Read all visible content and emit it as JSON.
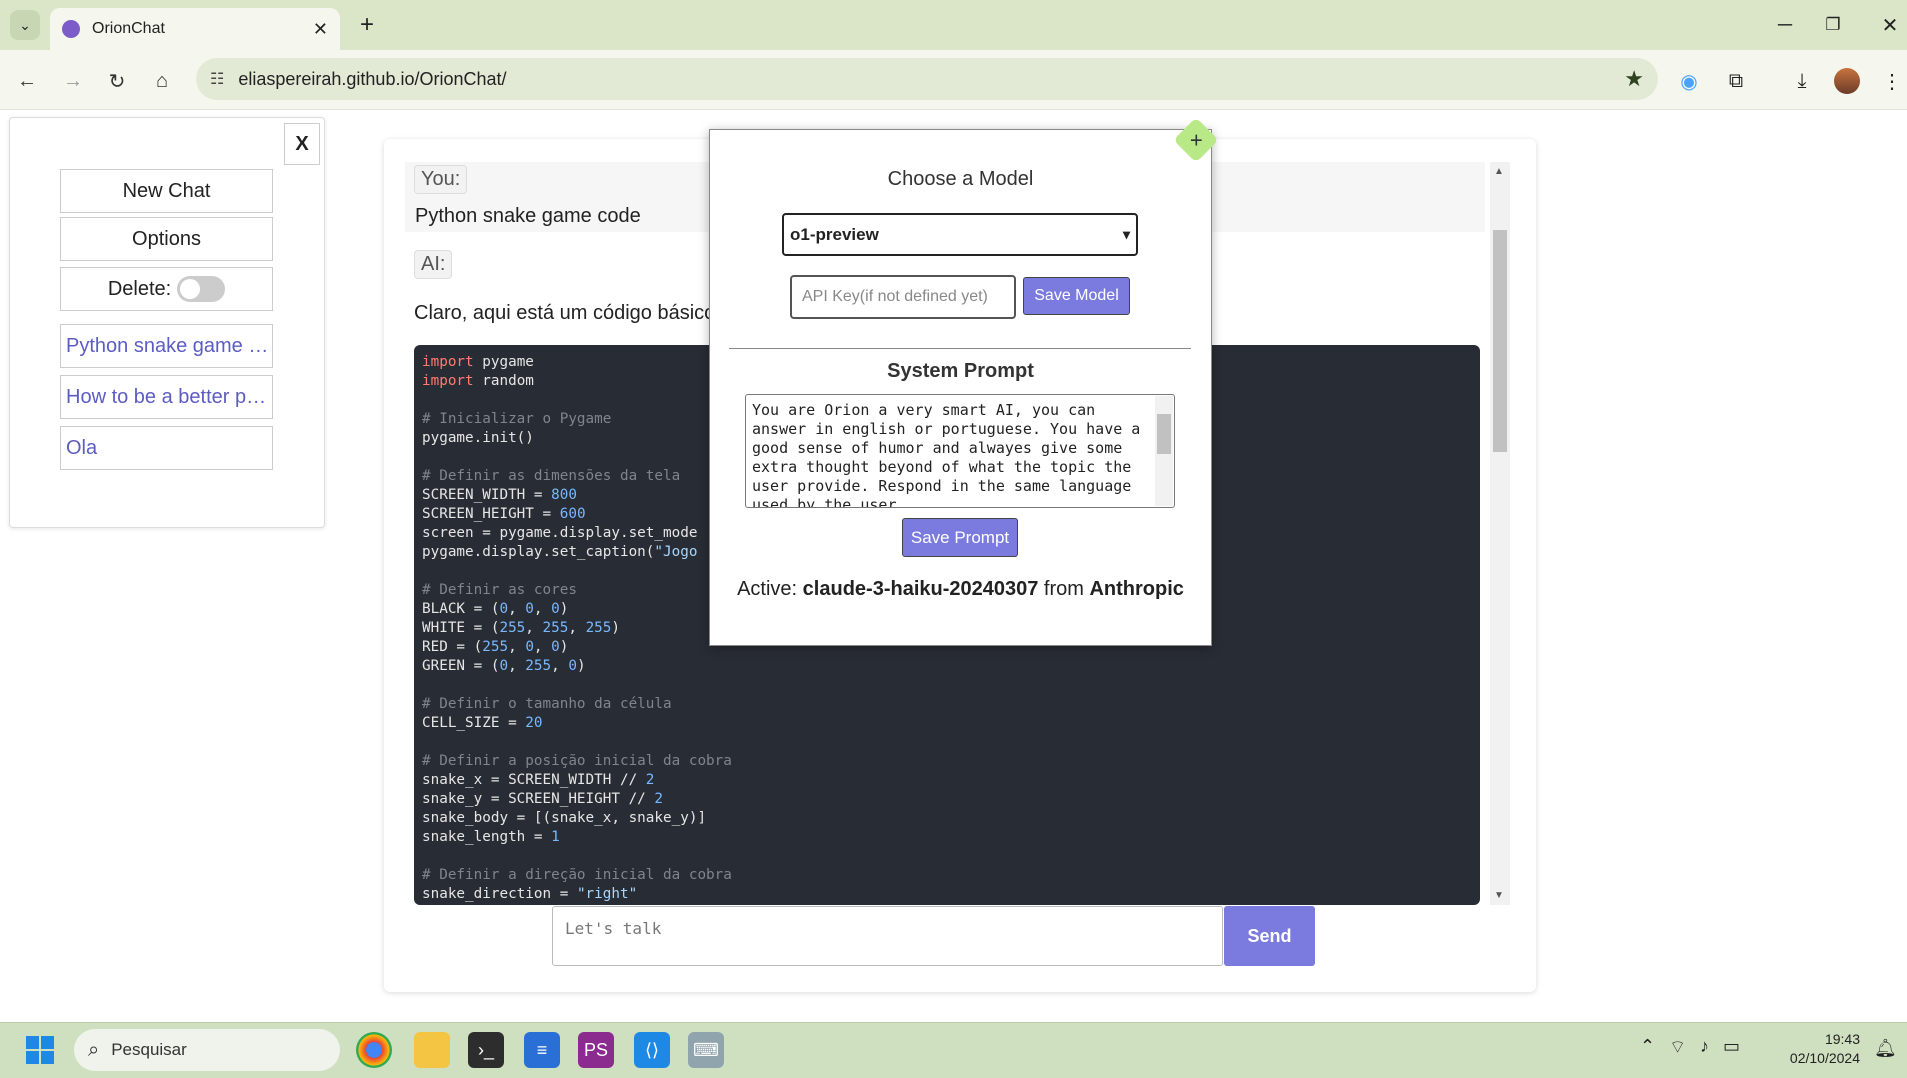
{
  "browser": {
    "tab_title": "OrionChat",
    "tab_close": "✕",
    "new_tab": "+",
    "url": "eliaspereirah.github.io/OrionChat/",
    "window_controls": [
      "─",
      "❐",
      "✕"
    ]
  },
  "sidebar": {
    "close_label": "X",
    "new_chat": "New Chat",
    "options": "Options",
    "delete_label": "Delete:",
    "history": [
      "Python snake game …",
      "How to be a better p…",
      "Ola"
    ]
  },
  "chat": {
    "you_tag": "You:",
    "user_message": "Python snake game code",
    "ai_tag": "AI:",
    "ai_intro": "Claro, aqui está um código básico",
    "input_placeholder": "Let's talk",
    "send_label": "Send",
    "code_lines": [
      [
        {
          "t": "import",
          "c": "kw"
        },
        {
          "t": " pygame",
          "c": ""
        }
      ],
      [
        {
          "t": "import",
          "c": "kw"
        },
        {
          "t": " random",
          "c": ""
        }
      ],
      [],
      [
        {
          "t": "# Inicializar o Pygame",
          "c": "cm"
        }
      ],
      [
        {
          "t": "pygame.init()",
          "c": ""
        }
      ],
      [],
      [
        {
          "t": "# Definir as dimensões da tela",
          "c": "cm"
        }
      ],
      [
        {
          "t": "SCREEN_WIDTH = ",
          "c": ""
        },
        {
          "t": "800",
          "c": "nm"
        }
      ],
      [
        {
          "t": "SCREEN_HEIGHT = ",
          "c": ""
        },
        {
          "t": "600",
          "c": "nm"
        }
      ],
      [
        {
          "t": "screen = pygame.display.set_mode",
          "c": ""
        }
      ],
      [
        {
          "t": "pygame.display.set_caption(",
          "c": ""
        },
        {
          "t": "\"Jogo",
          "c": "st"
        }
      ],
      [],
      [
        {
          "t": "# Definir as cores",
          "c": "cm"
        }
      ],
      [
        {
          "t": "BLACK = (",
          "c": ""
        },
        {
          "t": "0",
          "c": "nm"
        },
        {
          "t": ", ",
          "c": ""
        },
        {
          "t": "0",
          "c": "nm"
        },
        {
          "t": ", ",
          "c": ""
        },
        {
          "t": "0",
          "c": "nm"
        },
        {
          "t": ")",
          "c": ""
        }
      ],
      [
        {
          "t": "WHITE = (",
          "c": ""
        },
        {
          "t": "255",
          "c": "nm"
        },
        {
          "t": ", ",
          "c": ""
        },
        {
          "t": "255",
          "c": "nm"
        },
        {
          "t": ", ",
          "c": ""
        },
        {
          "t": "255",
          "c": "nm"
        },
        {
          "t": ")",
          "c": ""
        }
      ],
      [
        {
          "t": "RED = (",
          "c": ""
        },
        {
          "t": "255",
          "c": "nm"
        },
        {
          "t": ", ",
          "c": ""
        },
        {
          "t": "0",
          "c": "nm"
        },
        {
          "t": ", ",
          "c": ""
        },
        {
          "t": "0",
          "c": "nm"
        },
        {
          "t": ")",
          "c": ""
        }
      ],
      [
        {
          "t": "GREEN = (",
          "c": ""
        },
        {
          "t": "0",
          "c": "nm"
        },
        {
          "t": ", ",
          "c": ""
        },
        {
          "t": "255",
          "c": "nm"
        },
        {
          "t": ", ",
          "c": ""
        },
        {
          "t": "0",
          "c": "nm"
        },
        {
          "t": ")",
          "c": ""
        }
      ],
      [],
      [
        {
          "t": "# Definir o tamanho da célula",
          "c": "cm"
        }
      ],
      [
        {
          "t": "CELL_SIZE = ",
          "c": ""
        },
        {
          "t": "20",
          "c": "nm"
        }
      ],
      [],
      [
        {
          "t": "# Definir a posição inicial da cobra",
          "c": "cm"
        }
      ],
      [
        {
          "t": "snake_x = SCREEN_WIDTH // ",
          "c": ""
        },
        {
          "t": "2",
          "c": "nm"
        }
      ],
      [
        {
          "t": "snake_y = SCREEN_HEIGHT // ",
          "c": ""
        },
        {
          "t": "2",
          "c": "nm"
        }
      ],
      [
        {
          "t": "snake_body = [(snake_x, snake_y)]",
          "c": ""
        }
      ],
      [
        {
          "t": "snake_length = ",
          "c": ""
        },
        {
          "t": "1",
          "c": "nm"
        }
      ],
      [],
      [
        {
          "t": "# Definir a direção inicial da cobra",
          "c": "cm"
        }
      ],
      [
        {
          "t": "snake_direction = ",
          "c": ""
        },
        {
          "t": "\"right\"",
          "c": "st"
        }
      ]
    ]
  },
  "modal": {
    "title": "Choose a Model",
    "selected_model": "o1-preview",
    "api_key_placeholder": "API Key(if not defined yet)",
    "save_model": "Save Model",
    "system_prompt_title": "System Prompt",
    "system_prompt": "You are Orion a very smart AI, you can answer in english or portuguese. You have a good sense of humor and alwayes give some extra thought beyond of what the topic the user provide. Respond in the same language used by the user.",
    "save_prompt": "Save Prompt",
    "active_prefix": "Active:",
    "active_model": "claude-3-haiku-20240307",
    "active_mid": "from",
    "active_provider": "Anthropic"
  },
  "taskbar": {
    "search_label": "Pesquisar",
    "time": "19:43",
    "date": "02/10/2024"
  },
  "colors": {
    "accent": "#7b7bdf",
    "link": "#5c5cc2",
    "code_bg": "#282c34",
    "browser_frame": "#dbe6c9"
  }
}
